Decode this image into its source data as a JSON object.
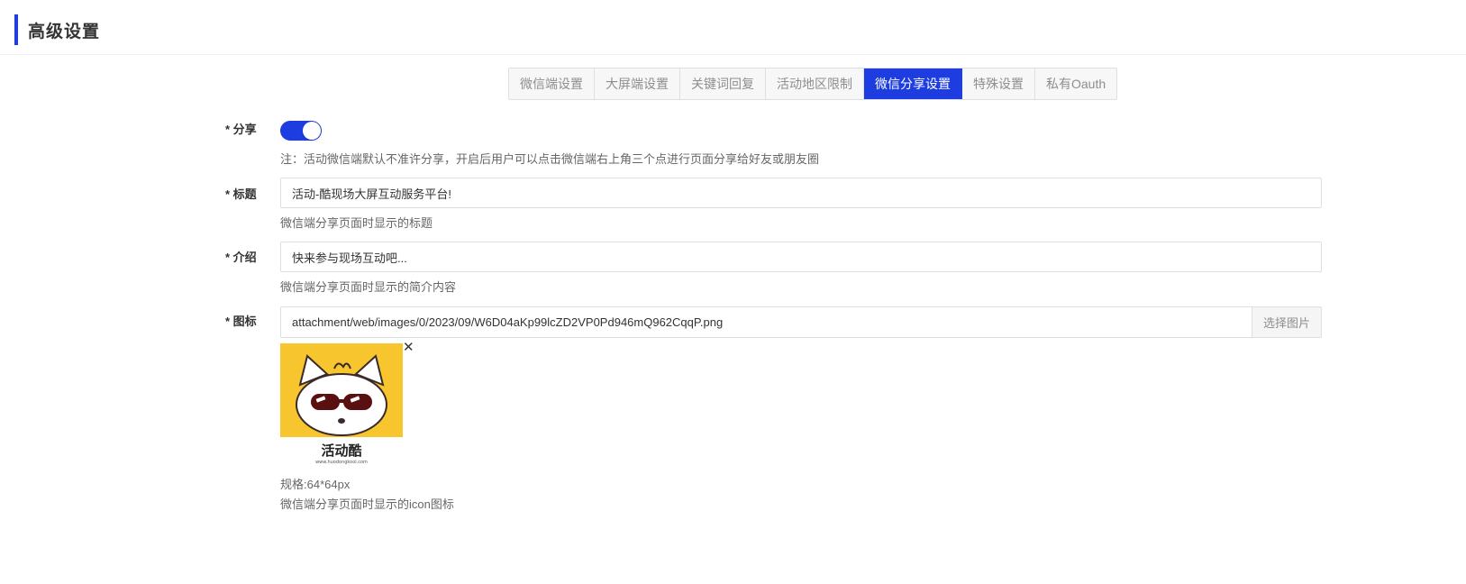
{
  "header": {
    "title": "高级设置"
  },
  "tabs": [
    {
      "label": "微信端设置",
      "active": false
    },
    {
      "label": "大屏端设置",
      "active": false
    },
    {
      "label": "关键词回复",
      "active": false
    },
    {
      "label": "活动地区限制",
      "active": false
    },
    {
      "label": "微信分享设置",
      "active": true
    },
    {
      "label": "特殊设置",
      "active": false
    },
    {
      "label": "私有Oauth",
      "active": false
    }
  ],
  "form": {
    "share": {
      "label": "* 分享",
      "enabled": true,
      "hint": "注：活动微信端默认不准许分享，开启后用户可以点击微信端右上角三个点进行页面分享给好友或朋友圈"
    },
    "title": {
      "label": "* 标题",
      "value": "活动-酷现场大屏互动服务平台!",
      "hint": "微信端分享页面时显示的标题"
    },
    "intro": {
      "label": "* 介绍",
      "value": "快来参与现场互动吧...",
      "hint": "微信端分享页面时显示的简介内容"
    },
    "icon": {
      "label": "* 图标",
      "value": "attachment/web/images/0/2023/09/W6D04aKp99lcZD2VP0Pd946mQ962CqqP.png",
      "button_label": "选择图片",
      "remove_symbol": "✕",
      "preview_text": "活动酷",
      "preview_url": "www.huodongkool.com",
      "spec": "规格:64*64px",
      "hint": "微信端分享页面时显示的icon图标"
    }
  },
  "colors": {
    "accent": "#1e3de0",
    "preview_bg": "#f7c52e"
  }
}
